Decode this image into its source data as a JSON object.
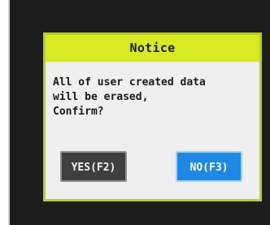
{
  "dialog": {
    "title": "Notice",
    "message": "All of user created data\nwill be erased,\nConfirm?",
    "buttons": {
      "yes_label": "YES(F2)",
      "no_label": "NO(F3)"
    }
  },
  "colors": {
    "screen_background": "#1c1c1c",
    "dialog_border": "#b6cf18",
    "title_bar": "#d7ea22",
    "dialog_body": "#efefef",
    "yes_button": "#3f3f3f",
    "no_button": "#1e88e5"
  }
}
